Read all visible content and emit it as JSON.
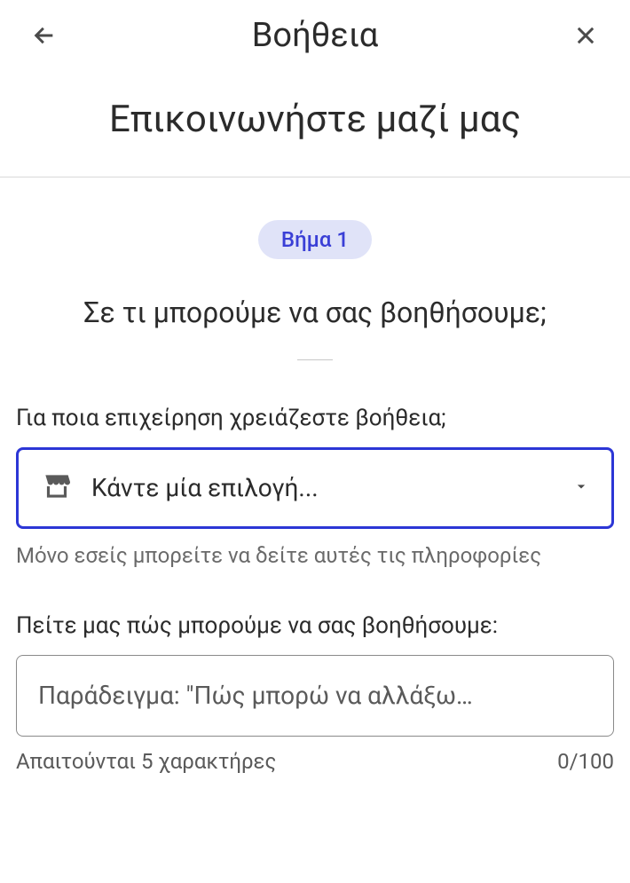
{
  "topbar": {
    "title": "Βοήθεια"
  },
  "page": {
    "heading": "Επικοινωνήστε μαζί μας"
  },
  "step": {
    "badge": "Βήμα 1",
    "heading": "Σε τι μπορούμε να σας βοηθήσουμε;"
  },
  "business_field": {
    "label": "Για ποια επιχείρηση χρειάζεστε βοήθεια;",
    "placeholder": "Κάντε μία επιλογή...",
    "helper": "Μόνο εσείς μπορείτε να δείτε αυτές τις πληροφορίες"
  },
  "message_field": {
    "label": "Πείτε μας πώς μπορούμε να σας βοηθήσουμε:",
    "placeholder": "Παράδειγμα: \"Πώς μπορώ να αλλάξω…",
    "requirement": "Απαιτούνται 5 χαρακτήρες",
    "counter": "0/100"
  }
}
